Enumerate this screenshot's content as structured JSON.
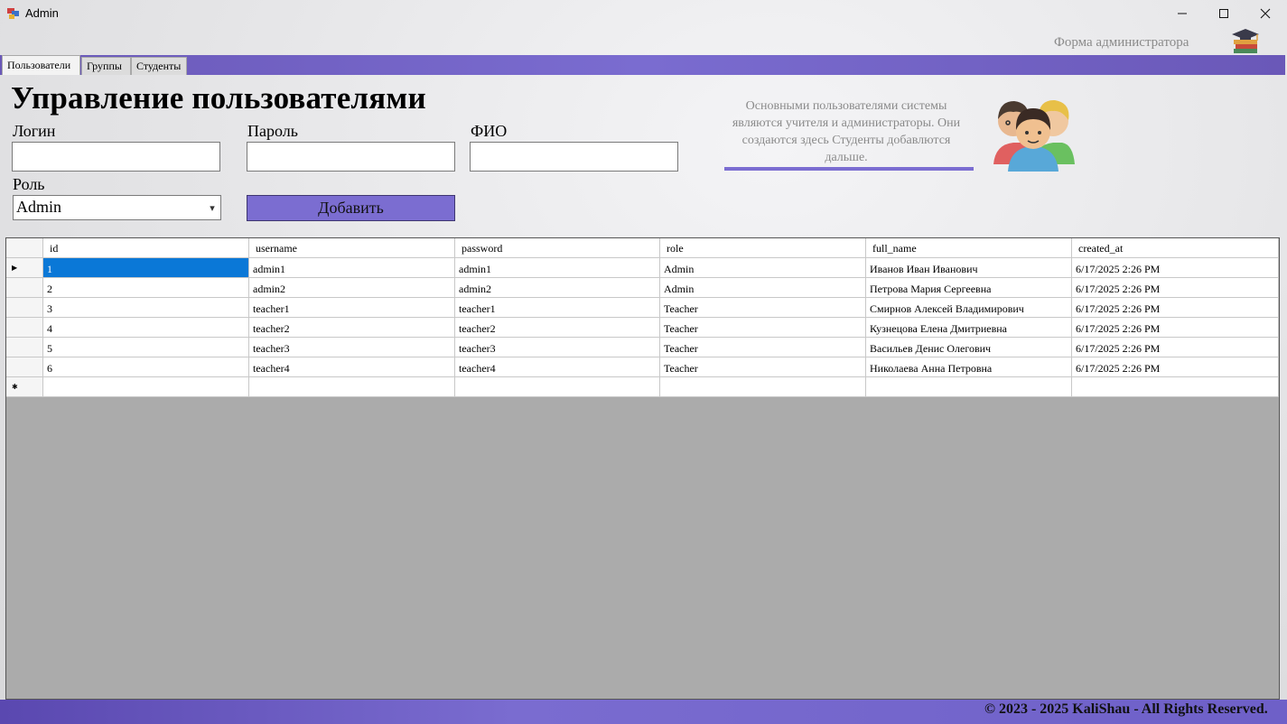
{
  "window": {
    "title": "Admin"
  },
  "header": {
    "caption": "Форма администратора"
  },
  "tabs": [
    {
      "label": "Пользователи",
      "active": true
    },
    {
      "label": "Группы",
      "active": false
    },
    {
      "label": "Студенты",
      "active": false
    }
  ],
  "page": {
    "title": "Управление пользователями"
  },
  "form": {
    "login_label": "Логин",
    "login_value": "",
    "password_label": "Пароль",
    "password_value": "",
    "fio_label": "ФИО",
    "fio_value": "",
    "role_label": "Роль",
    "role_value": "Admin",
    "add_button": "Добавить"
  },
  "info": {
    "text": "Основными пользователями системы являются учителя и администраторы. Они создаются здесь Студенты добавлются дальше."
  },
  "grid": {
    "columns": [
      "id",
      "username",
      "password",
      "role",
      "full_name",
      "created_at"
    ],
    "rows": [
      [
        "1",
        "admin1",
        "admin1",
        "Admin",
        "Иванов Иван Иванович",
        "6/17/2025 2:26 PM"
      ],
      [
        "2",
        "admin2",
        "admin2",
        "Admin",
        "Петрова Мария Сергеевна",
        "6/17/2025 2:26 PM"
      ],
      [
        "3",
        "teacher1",
        "teacher1",
        "Teacher",
        "Смирнов Алексей Владимирович",
        "6/17/2025 2:26 PM"
      ],
      [
        "4",
        "teacher2",
        "teacher2",
        "Teacher",
        "Кузнецова Елена Дмитриевна",
        "6/17/2025 2:26 PM"
      ],
      [
        "5",
        "teacher3",
        "teacher3",
        "Teacher",
        "Васильев Денис Олегович",
        "6/17/2025 2:26 PM"
      ],
      [
        "6",
        "teacher4",
        "teacher4",
        "Teacher",
        "Николаева Анна Петровна",
        "6/17/2025 2:26 PM"
      ]
    ]
  },
  "footer": {
    "text": "© 2023 - 2025 KaliShau - All Rights Reserved."
  },
  "colors": {
    "accent": "#7b6dd1",
    "selection": "#0a78d7"
  },
  "icons": [
    "app-icon",
    "minimize-icon",
    "maximize-icon",
    "close-icon",
    "graduation-books-icon",
    "people-group-icon",
    "row-pointer-icon",
    "new-row-icon"
  ]
}
